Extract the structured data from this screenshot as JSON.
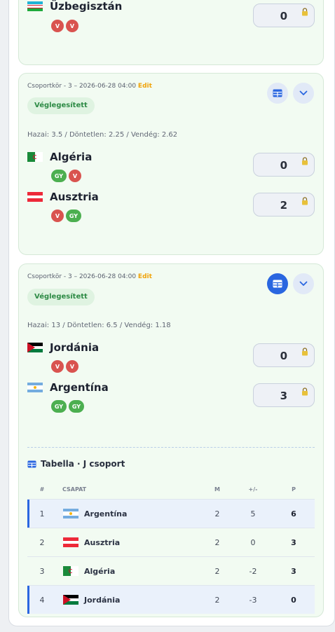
{
  "match_top": {
    "team_b": {
      "name": "Üzbegisztán",
      "badges": [
        "V",
        "V"
      ],
      "score": "0"
    }
  },
  "match2": {
    "meta": "Csoportkör - 3 – 2026-06-28 04:00",
    "edit_label": "Edit",
    "status": "Véglegesített",
    "odds": "Hazai: 3.5 / Döntetlen: 2.25 / Vendég: 2.62",
    "team_a": {
      "name": "Algéria",
      "badges": [
        "GY",
        "V"
      ],
      "score": "0"
    },
    "team_b": {
      "name": "Ausztria",
      "badges": [
        "V",
        "GY"
      ],
      "score": "2"
    }
  },
  "match3": {
    "meta": "Csoportkör - 3 – 2026-06-28 04:00",
    "edit_label": "Edit",
    "status": "Véglegesített",
    "odds": "Hazai: 13 / Döntetlen: 6.5 / Vendég: 1.18",
    "team_a": {
      "name": "Jordánia",
      "badges": [
        "V",
        "V"
      ],
      "score": "0"
    },
    "team_b": {
      "name": "Argentína",
      "badges": [
        "GY",
        "GY"
      ],
      "score": "3"
    }
  },
  "standings": {
    "title": "Tabella · J csoport",
    "headers": {
      "rank": "#",
      "team": "CSAPAT",
      "played": "M",
      "diff": "+/-",
      "points": "P"
    },
    "rows": [
      {
        "rank": "1",
        "team": "Argentína",
        "played": "2",
        "diff": "5",
        "points": "6"
      },
      {
        "rank": "2",
        "team": "Ausztria",
        "played": "2",
        "diff": "0",
        "points": "3"
      },
      {
        "rank": "3",
        "team": "Algéria",
        "played": "2",
        "diff": "-2",
        "points": "3"
      },
      {
        "rank": "4",
        "team": "Jordánia",
        "played": "2",
        "diff": "-3",
        "points": "0"
      }
    ]
  },
  "colors": {
    "accent": "#2a66e0",
    "card_bg": "#f2fbf2",
    "status_green": "#2e8b46",
    "edit_orange": "#f0a30a",
    "badge_v": "#d9534f",
    "badge_gy": "#4caf50"
  }
}
